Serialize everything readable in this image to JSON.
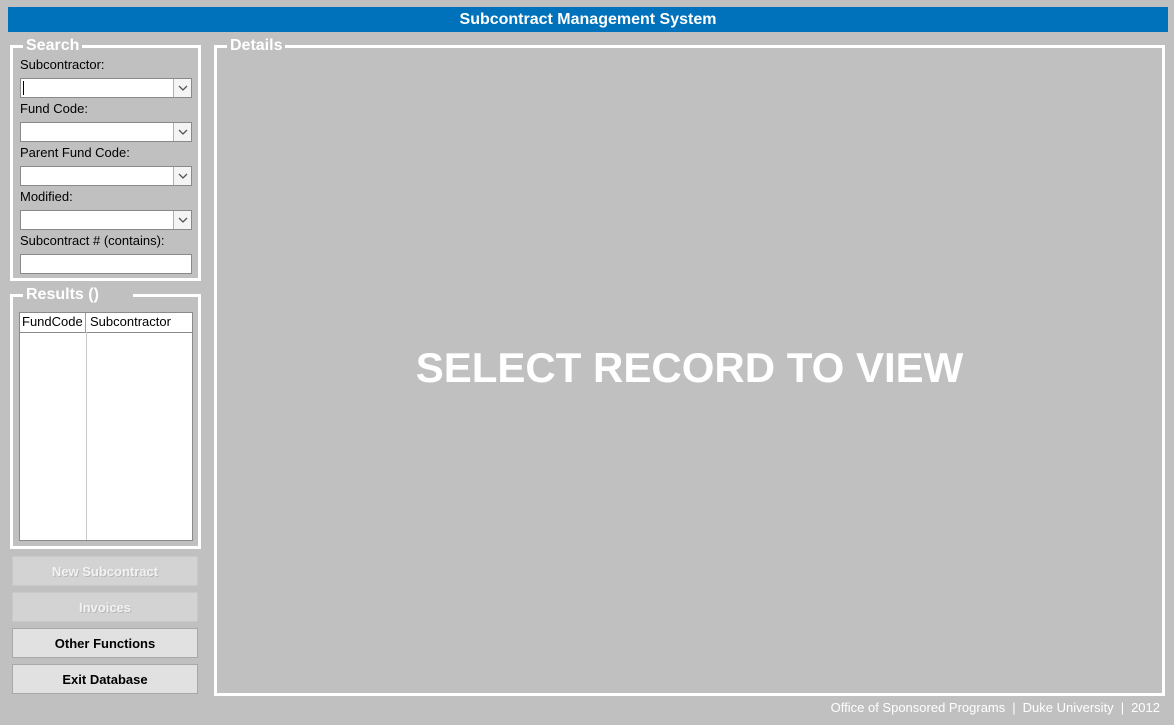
{
  "app": {
    "title": "Subcontract Management System"
  },
  "search": {
    "legend": "Search",
    "subcontractor_label": "Subcontractor:",
    "fund_code_label": "Fund Code:",
    "parent_fund_code_label": "Parent Fund Code:",
    "modified_label": "Modified:",
    "subcontract_number_label": "Subcontract # (contains):",
    "subcontractor_value": "",
    "fund_code_value": "",
    "parent_fund_code_value": "",
    "modified_value": "",
    "subcontract_number_value": ""
  },
  "results": {
    "legend": "Results ()",
    "columns": [
      "FundCode",
      "Subcontractor"
    ],
    "rows": []
  },
  "buttons": {
    "new_subcontract": "New Subcontract",
    "invoices": "Invoices",
    "other_functions": "Other Functions",
    "exit_database": "Exit Database"
  },
  "details": {
    "legend": "Details",
    "placeholder": "SELECT RECORD TO VIEW"
  },
  "footer": {
    "office": "Office of Sponsored Programs",
    "university": "Duke University",
    "year": "2012"
  },
  "colors": {
    "title_bar": "#0072bc",
    "background": "#c0c0c0"
  },
  "icons": {
    "dropdown": "chevron-down-icon"
  }
}
